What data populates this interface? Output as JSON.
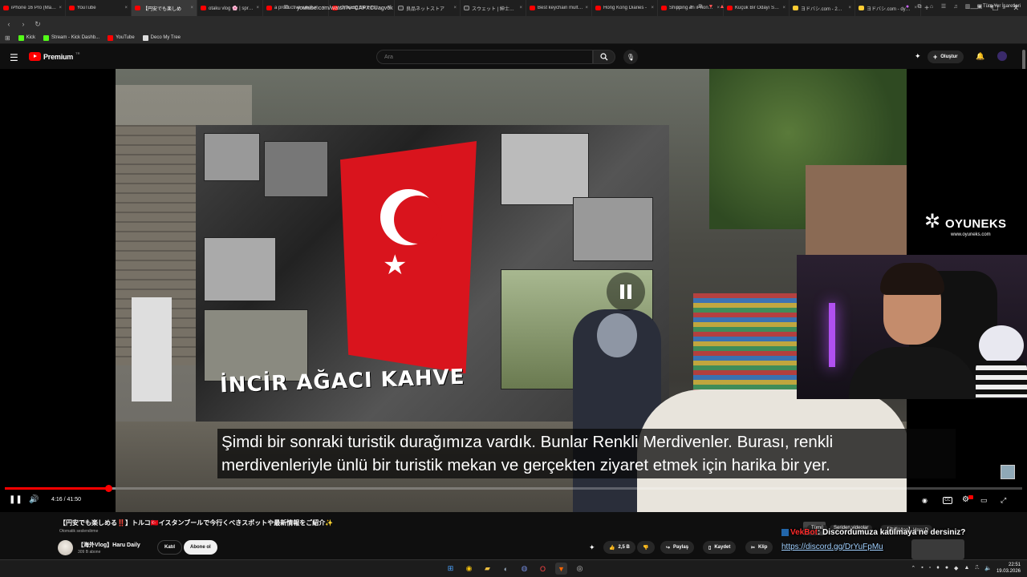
{
  "browser": {
    "tabs": [
      {
        "label": "iPhone 16 Pro (Max) -",
        "fav": "youtube"
      },
      {
        "label": "YouTube",
        "fav": "youtube"
      },
      {
        "label": "【円安でも楽しめ",
        "fav": "youtube",
        "active": true
      },
      {
        "label": "otaku vlog 🌸 | spring",
        "fav": "youtube"
      },
      {
        "label": "a productive week in",
        "fav": "youtube"
      },
      {
        "label": "Chasing the First Saku",
        "fav": "youtube"
      },
      {
        "label": "良品ネットストア",
        "fav": "muji"
      },
      {
        "label": "スウェット | 紳士・メンズ",
        "fav": "muji"
      },
      {
        "label": "Best keychain multito",
        "fav": "youtube"
      },
      {
        "label": "Hong Kong Diaries -",
        "fav": "youtube"
      },
      {
        "label": "Shipping an iPhone A",
        "fav": "youtube"
      },
      {
        "label": "Küçük Bir Odayı Salon",
        "fav": "youtube"
      },
      {
        "label": "ヨドバシ.com - 2ページ目",
        "fav": "yodobashi"
      },
      {
        "label": "ヨドバシ.com - dyson",
        "fav": "yodobashi"
      }
    ],
    "url": "youtube.com/watch?v=CAPXCUagv6k",
    "bookmarks": [
      {
        "label": "Kick",
        "color": "#53fc18"
      },
      {
        "label": "Stream - Kick Dashb...",
        "color": "#53fc18"
      },
      {
        "label": "YouTube",
        "color": "#ff0000"
      },
      {
        "label": "Deco My Tree",
        "color": "#dddddd"
      }
    ],
    "all_bookmarks": "Tüm Yer İşaretleri"
  },
  "youtube": {
    "logo_text": "Premium",
    "logo_region": "TR",
    "search_placeholder": "Ara",
    "create_label": "Oluştur"
  },
  "player": {
    "subtitle_line1": "Şimdi bir sonraki turistik durağımıza vardık. Bunlar Renkli Merdivenler. Burası, renkli",
    "subtitle_line2": "merdivenleriyle ünlü bir turistik mekan ve gerçekten ziyaret etmek için harika bir yer.",
    "time_display": "4:16 / 41:50",
    "played_fraction": 0.102,
    "buffered_fraction": 0.109,
    "scene_text": "İNCİR AĞACI KAHVE",
    "accent": "#ff0000"
  },
  "overlay": {
    "sponsor_name": "OYUNEKS",
    "sponsor_url": "www.oyuneks.com",
    "chat_user": "VekBot",
    "chat_message": ": Discordumuza katılmaya ne dersiniz?",
    "chat_link": "https://discord.gg/DrYuFpMu"
  },
  "video": {
    "title": "【円安でも楽しめる‼️】トルコ🇹🇷イスタンブールで今行くべきスポットや最新情報をご紹介✨",
    "auto_dub": "Otomatik seslendirme",
    "channel_name": "【海外Vlog】Haru Daily",
    "channel_subs": "309 B abone",
    "join_label": "Katıl",
    "subscribe_label": "Abone ol",
    "like_count": "2,5 B",
    "share_label": "Paylaş",
    "save_label": "Kaydet",
    "clip_label": "Klip"
  },
  "suggestions": {
    "chip_all": "Tümü",
    "chip_series": "Seriden videolar",
    "chip_channel": "【海外Vlog】Haru D"
  },
  "taskbar": {
    "time": "22:51",
    "date": "19.03.2026"
  }
}
